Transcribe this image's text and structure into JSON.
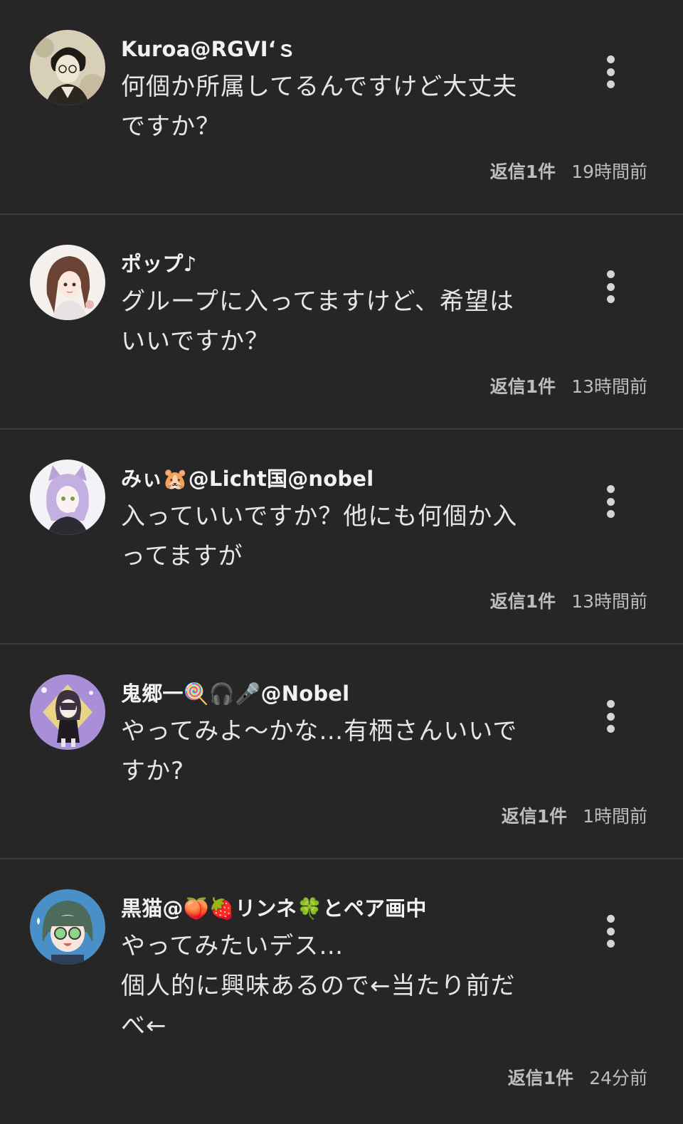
{
  "comments": [
    {
      "author": "Kuroa@RGVI‘ｓ",
      "text": "何個か所属してるんですけど大丈夫\nですか？",
      "replies": "返信1件",
      "time": "19時間前",
      "avatar": "dark-haired-man-with-glasses-avatar"
    },
    {
      "author": "ポップ♪",
      "text": "グループに入ってますけど、希望は\nいいですか？",
      "replies": "返信1件",
      "time": "13時間前",
      "avatar": "ponytail-girl-avatar"
    },
    {
      "author": "みぃ🐹@Licht国@nobel",
      "text": "入っていいですか？他にも何個か入\nってますが",
      "replies": "返信1件",
      "time": "13時間前",
      "avatar": "cat-eared-purple-hair-avatar"
    },
    {
      "author": "鬼郷一🍭🎧🎤@Nobel",
      "text": "やってみよ～かな…有栖さんいいで\nすか?",
      "replies": "返信1件",
      "time": "1時間前",
      "avatar": "chibi-character-purple-background-avatar"
    },
    {
      "author": "黒猫@🍑🍓リンネ🍀とペア画中",
      "text": "やってみたいデス…\n個人的に興味あるので←当たり前だ\nべ←",
      "replies": "返信1件",
      "time": "24分前",
      "avatar": "green-hair-glasses-avatar"
    }
  ],
  "colors": {
    "background": "#262626",
    "divider": "#3d3d3d",
    "text": "#e6e6e6",
    "meta": "#bdbdbd"
  }
}
